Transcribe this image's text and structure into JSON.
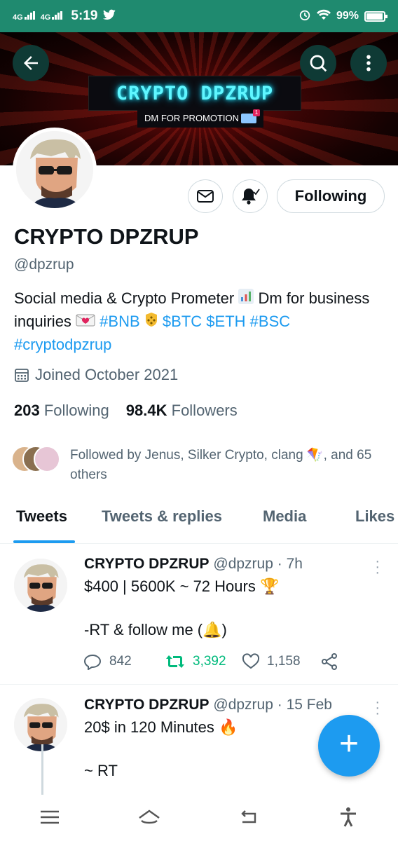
{
  "status_bar": {
    "network_1": "4G",
    "network_2": "4G",
    "time": "5:19",
    "battery": "99%"
  },
  "banner": {
    "brand_text": "CRYPTO DPZRUP",
    "promo_text": "DM FOR PROMOTION"
  },
  "profile": {
    "display_name": "CRYPTO DPZRUP",
    "handle": "@dpzrup",
    "follow_button_label": "Following",
    "bio": {
      "part1": "Social media & Crypto Prometer ",
      "part2": " Dm for business inquiries ",
      "tag_bnb": "#BNB",
      "tag_btc": "$BTC",
      "tag_eth": "$ETH",
      "tag_bsc": "#BSC",
      "tag_cryptodpzrup": "#cryptodpzrup"
    },
    "joined": "Joined October 2021",
    "following_count": "203",
    "following_label": "Following",
    "followers_count": "98.4K",
    "followers_label": "Followers",
    "followed_by": "Followed by Jenus, Silker Crypto, clang 🪁, and 65 others"
  },
  "tabs": [
    {
      "label": "Tweets"
    },
    {
      "label": "Tweets & replies"
    },
    {
      "label": "Media"
    },
    {
      "label": "Likes"
    }
  ],
  "tweets": [
    {
      "name": "CRYPTO DPZRUP",
      "handle_time": "@dpzrup · 7h",
      "line1": "$400 | 5600K ~ 72 Hours 🏆",
      "line2": "-RT & follow me (🔔)",
      "replies": "842",
      "retweets": "3,392",
      "likes": "1,158"
    },
    {
      "name": "CRYPTO DPZRUP",
      "handle_time": "@dpzrup · 15 Feb",
      "line1": "20$ in 120 Minutes 🔥",
      "line2": "~ RT"
    }
  ],
  "colors": {
    "accent": "#1d9bf0",
    "retweet": "#00ba7c",
    "status_bar": "#1f8a6f",
    "text_secondary": "#536471"
  },
  "icons": [
    "back-arrow-icon",
    "search-icon",
    "more-vertical-icon",
    "mail-icon",
    "bell-icon",
    "calendar-icon",
    "reply-icon",
    "retweet-icon",
    "like-icon",
    "share-icon",
    "compose-icon"
  ]
}
